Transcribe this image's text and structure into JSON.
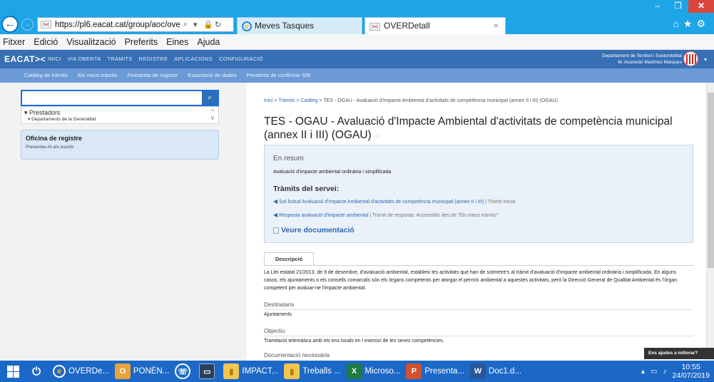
{
  "window": {
    "minimize": "–",
    "maximize": "❐",
    "close": "✕"
  },
  "browser": {
    "url": "https://pl6.eacat.cat/group/aoc/ove",
    "tabs": [
      {
        "label": "Meves Tasques"
      },
      {
        "label": "OVERDetall"
      }
    ],
    "tab_close": "×",
    "toolbar_icons": "⌂★⚙"
  },
  "menu": [
    "Fitxer",
    "Edició",
    "Visualització",
    "Preferits",
    "Eines",
    "Ajuda"
  ],
  "site": {
    "logo": "EACAT><",
    "nav": [
      "INICI",
      "VIA OBERTA",
      "TRÀMITS",
      "REGISTRE",
      "APLICACIONS",
      "CONFIGURACIÓ"
    ],
    "department": "Departament de Territori i Sostenibilitat",
    "user": "M. Asunción Martínez Marques",
    "subnav": [
      "Catàleg de tràmits",
      "Els meus tràmits",
      "Finestreta de registre",
      "Exportació de dades",
      "Pendents de confirmar SIR"
    ]
  },
  "sidebar": {
    "search_placeholder": "",
    "prestadors": "▾ Prestadors",
    "prestadors_sub": "▾ Departaments de la Generalitat",
    "oficina_title": "Oficina de registre",
    "oficina_sub": "Presenteu-hi els escrits"
  },
  "main": {
    "breadcrumb": {
      "inici": "Inici",
      "tramits": "Tràmits",
      "cataleg": "Catàleg",
      "current": "TES - OGAU - Avaluació d'Impacte Ambiental d'activitats de competència municipal (annex II i III) (OGAU)"
    },
    "title": "TES - OGAU - Avaluació d'Impacte Ambiental d'activitats de competència municipal (annex II i III) (OGAU)",
    "resum": {
      "heading": "En resum",
      "description": "Avaluació d'impacte ambiental ordinària i simplificada",
      "tramits_heading": "Tràmits del servei:",
      "link1": "Sol·licitud Avaluació d'Impacte Ambiental d'activitats de competència municipal (annex II i III)",
      "link1_note": "| Tràmit inicial",
      "link2": "Resposta avaluació d'impacte ambiental",
      "link2_note": "| Tràmit de resposta. Accessible des de \"Els meus tràmits\"",
      "doc_link": "Veure documentació"
    },
    "tab_label": "Descripció",
    "description": "La Llei estatal 21/2013, de 9 de desembre, d'avaluació ambiental, estableix les activitats que han de sotmetre's al tràmit d'avaluació d'impacte ambiental ordinària i simplificada. En alguns casos, els ajuntaments o els consells comarcals són els òrgans competents per atorgar el permís ambiental a aquestes activitats, però la Direcció General de Qualitat Ambiental és l'òrgan competent per avaluar-ne l'impacte ambiental.",
    "destinataris_label": "Destinataris",
    "destinataris_value": "Ajuntaments",
    "objectiu_label": "Objectiu",
    "objectiu_value": "Tramitació telemàtica amb els ens locals en l exercici de les seves competències.",
    "documentacio_label": "Documentació necessària"
  },
  "toast": "Ens ajudes a millorar?",
  "taskbar": {
    "items": [
      "OVERDe...",
      "PONÈN...",
      "",
      "",
      "IMPACT...",
      "Treballs ...",
      "Microso...",
      "Presenta...",
      "Doc1.d..."
    ],
    "time": "10:55",
    "date": "24/07/2019"
  }
}
